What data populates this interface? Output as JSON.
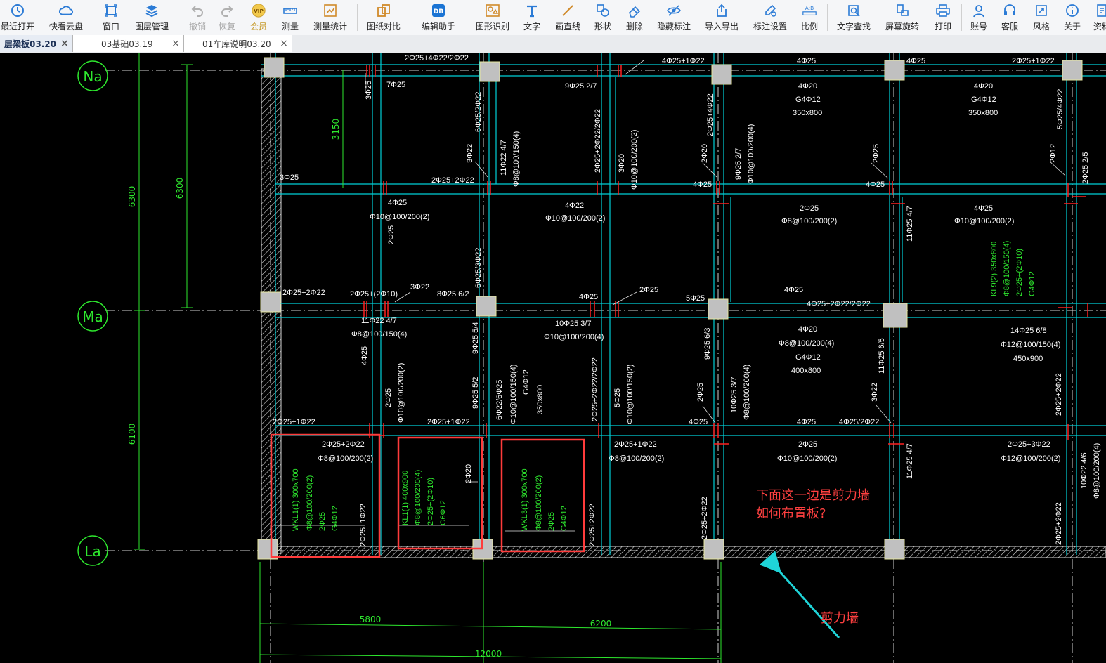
{
  "toolbar": {
    "items": [
      {
        "label": "最近打开",
        "icon": "clock-icon"
      },
      {
        "label": "快看云盘",
        "icon": "cloud-icon"
      },
      {
        "label": "窗口",
        "icon": "window-icon"
      },
      {
        "label": "图层管理",
        "icon": "layers-icon"
      },
      {
        "label": "撤销",
        "icon": "undo-icon"
      },
      {
        "label": "恢复",
        "icon": "redo-icon"
      },
      {
        "label": "会员",
        "icon": "vip-icon"
      },
      {
        "label": "测量",
        "icon": "ruler-icon"
      },
      {
        "label": "测量统计",
        "icon": "measure-stats-icon"
      },
      {
        "label": "图纸对比",
        "icon": "compare-icon"
      },
      {
        "label": "编辑助手",
        "icon": "edit-assistant-icon"
      },
      {
        "label": "图形识别",
        "icon": "shape-recognize-icon"
      },
      {
        "label": "文字",
        "icon": "text-icon"
      },
      {
        "label": "画直线",
        "icon": "line-icon"
      },
      {
        "label": "形状",
        "icon": "shape-icon"
      },
      {
        "label": "删除",
        "icon": "eraser-icon"
      },
      {
        "label": "隐藏标注",
        "icon": "hide-eye-icon"
      },
      {
        "label": "导入导出",
        "icon": "import-export-icon"
      },
      {
        "label": "标注设置",
        "icon": "annotation-settings-icon"
      },
      {
        "label": "比例",
        "icon": "scale-icon"
      },
      {
        "label": "文字查找",
        "icon": "text-search-icon"
      },
      {
        "label": "屏幕旋转",
        "icon": "rotate-screen-icon"
      },
      {
        "label": "打印",
        "icon": "printer-icon"
      },
      {
        "label": "账号",
        "icon": "account-icon"
      },
      {
        "label": "客服",
        "icon": "headset-icon"
      },
      {
        "label": "风格",
        "icon": "style-icon"
      },
      {
        "label": "关于",
        "icon": "info-icon"
      },
      {
        "label": "资料",
        "icon": "docs-icon"
      }
    ],
    "vip_icon_text": "VIP",
    "scale_icon_text": "A:B",
    "edit_icon_text": "DB"
  },
  "tabs": [
    {
      "label": "层梁板03.20",
      "close": "×",
      "active": true
    },
    {
      "label": "03基础03.19",
      "close": "×",
      "active": false
    },
    {
      "label": "01车库说明03.20",
      "close": "×",
      "active": false
    }
  ],
  "drawing": {
    "grid_axes": [
      "Na",
      "Ma",
      "La"
    ],
    "dimensions": {
      "span_a": "6300",
      "span_b": "6100",
      "span_c": "6300",
      "sub_a": "3150",
      "bottom_1": "5800",
      "bottom_2": "6200",
      "bottom_total": "12000"
    },
    "white_annotations": [
      "2Φ25+4Φ22/2Φ22",
      "4Φ25+1Φ22",
      "4Φ25",
      "4Φ25",
      "2Φ25+1Φ22",
      "7Φ25",
      "9Φ25 2/7",
      "3Φ25",
      "6Φ25/2Φ22",
      "4Φ20",
      "G4Φ12",
      "350x800",
      "4Φ20",
      "G4Φ12",
      "350x800",
      "11Φ22 4/7",
      "Φ8@100/150(4)",
      "2Φ25+2Φ22/2Φ22",
      "3Φ20",
      "Φ10@100/200(2)",
      "2Φ25+4Φ22",
      "9Φ25 2/7",
      "Φ10@100/200(4)",
      "3Φ22",
      "2Φ20",
      "2Φ25",
      "2Φ12",
      "5Φ25/4Φ22",
      "2Φ25 2/5",
      "3Φ25",
      "2Φ25+2Φ22",
      "4Φ25",
      "4Φ25",
      "4Φ25",
      "Φ10@100/200(2)",
      "2Φ25",
      "4Φ22",
      "Φ10@100/200(2)",
      "2Φ25",
      "Φ8@100/200(2)",
      "4Φ25",
      "Φ10@100/200(2)",
      "6Φ25/3Φ22",
      "11Φ25 4/7",
      "2Φ25+2Φ22",
      "2Φ25+(2Φ10)",
      "3Φ22",
      "8Φ25 6/2",
      "4Φ25",
      "2Φ25",
      "5Φ25",
      "4Φ25",
      "4Φ25+2Φ22/2Φ22",
      "11Φ22 4/7",
      "Φ8@100/150(4)",
      "10Φ25 3/7",
      "Φ10@100/200(4)",
      "4Φ20",
      "Φ8@100/200(4)",
      "G4Φ12",
      "400x800",
      "14Φ25 6/8",
      "Φ12@100/150(4)",
      "450x900",
      "4Φ25",
      "2Φ25",
      "Φ10@100/200(2)",
      "9Φ25 5/4",
      "9Φ25 5/2",
      "6Φ22/6Φ25",
      "Φ10@100/150(4)",
      "G4Φ12",
      "350x800",
      "2Φ25+2Φ22/2Φ22",
      "5Φ25",
      "Φ10@100/150(2)",
      "9Φ25 6/3",
      "2Φ25",
      "10Φ25 3/7",
      "Φ8@100/200(4)",
      "11Φ25 6/5",
      "3Φ22",
      "2Φ25+2Φ22",
      "2Φ25+1Φ22",
      "2Φ25+1Φ22",
      "4Φ25",
      "4Φ25",
      "4Φ25/2Φ22",
      "2Φ25+2Φ22",
      "Φ8@100/200(2)",
      "2Φ20",
      "2Φ25+1Φ22",
      "2Φ25+1Φ22",
      "2Φ25+2Φ22",
      "Φ8@100/200(2)",
      "2Φ25",
      "Φ10@100/200(2)",
      "2Φ25+2Φ22",
      "2Φ25+3Φ22",
      "Φ12@100/200(2)",
      "11Φ25 4/7",
      "2Φ25+2Φ22",
      "10Φ22 4/6",
      "Φ8@100/200(4)"
    ],
    "green_beam_labels": [
      "WKL1(1) 300x700",
      "Φ8@100/200(2)",
      "2Φ25",
      "G4Φ12",
      "KL1(1) 400x900",
      "Φ8@100/200(4)",
      "2Φ25+(2Φ10)",
      "G6Φ12",
      "WKL3(1) 300x700",
      "Φ8@100/200(2)",
      "2Φ25",
      "G4Φ12",
      "KL9(2) 350x800",
      "Φ8@100/150(4)",
      "2Φ25+(2Φ10)",
      "G4Φ12"
    ],
    "note_question_line1": "下面这一边是剪力墙",
    "note_question_line2": "如何布置板?",
    "note_shear_wall": "剪力墙",
    "colors": {
      "background": "#000000",
      "beam_line": "#00d0d8",
      "gridline": "#cfcfcf",
      "dimension": "#2ee82e",
      "column": "#c0c0c0",
      "rebar_mark": "#ff2020",
      "highlight_box": "#ff3b3b",
      "note_text": "#ff4040",
      "arrow": "#1fd4d8",
      "wall_hatch": "#d8d8d8"
    }
  }
}
